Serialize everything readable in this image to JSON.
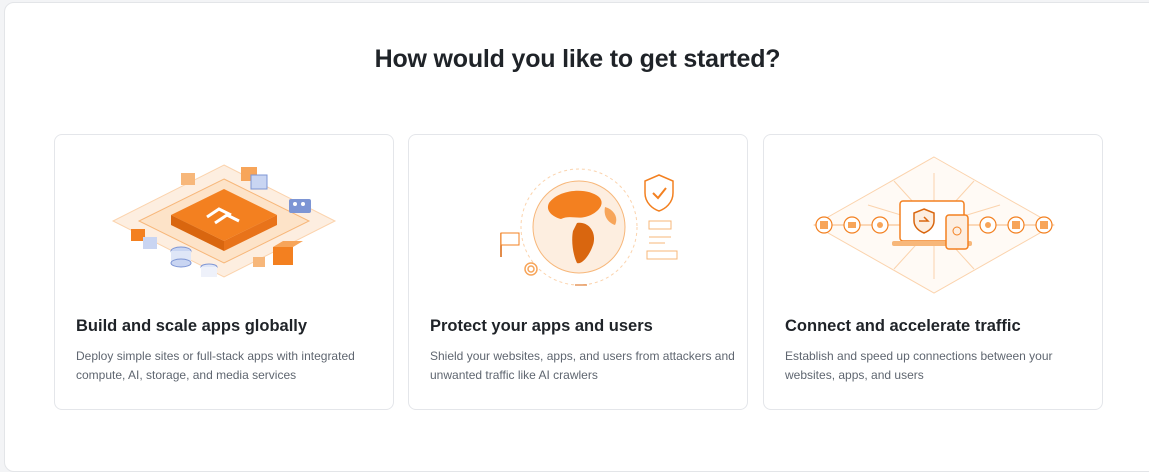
{
  "page": {
    "heading": "How would you like to get started?"
  },
  "cards": [
    {
      "title": "Build and scale apps globally",
      "description": "Deploy simple sites or full-stack apps with integrated compute, AI, storage, and media services",
      "illustration": "isometric-platform-illustration"
    },
    {
      "title": "Protect your apps and users",
      "description": "Shield your websites, apps, and users from attackers and unwanted traffic like AI crawlers",
      "illustration": "globe-shield-illustration"
    },
    {
      "title": "Connect and accelerate traffic",
      "description": "Establish and speed up connections between your websites, apps, and users",
      "illustration": "connected-devices-illustration"
    }
  ],
  "colors": {
    "accent": "#f38020",
    "accent_light": "#fbd3ad",
    "accent_pale": "#fdeee0",
    "blue": "#7d95d4",
    "text": "#1f2328",
    "muted": "#5f6670"
  }
}
